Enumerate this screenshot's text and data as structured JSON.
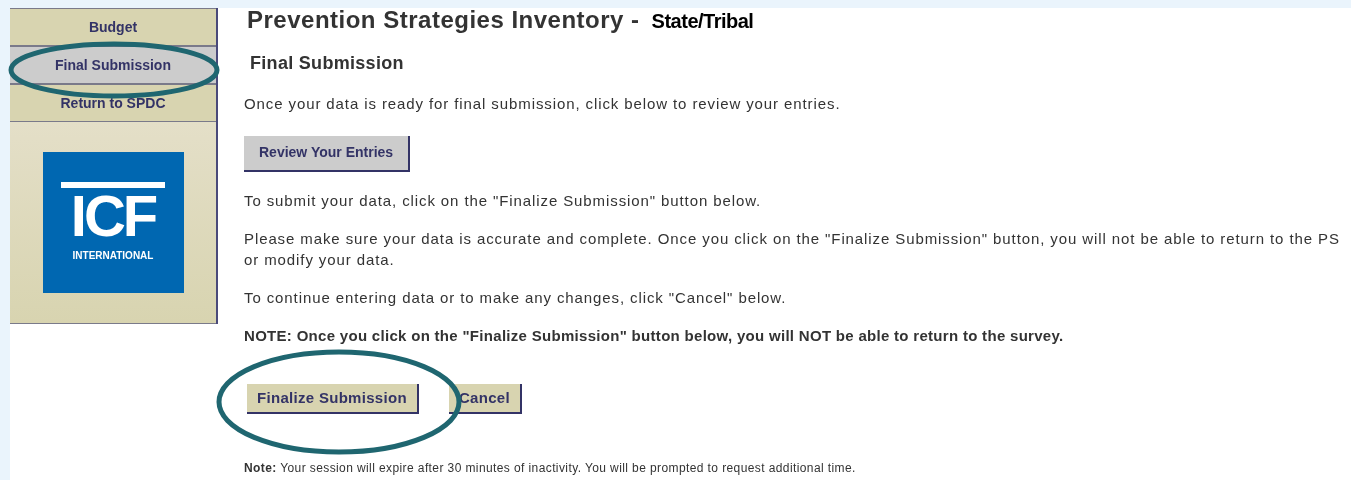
{
  "sidebar": {
    "items": [
      {
        "label": "Budget",
        "selected": false
      },
      {
        "label": "Final Submission",
        "selected": true
      },
      {
        "label": "Return to SPDC",
        "selected": false
      }
    ],
    "logo": {
      "letters": "ICF",
      "tagline": "INTERNATIONAL"
    }
  },
  "title": "Prevention Strategies Inventory -",
  "title_tag": "State/Tribal",
  "heading": "Final Submission",
  "intro": "Once your data is ready for final submission, click below to review your entries.",
  "review_button": "Review Your Entries",
  "paragraphs": [
    {
      "lines": [
        "To submit your data, click on the \"Finalize Submission\" button below."
      ]
    },
    {
      "lines": [
        "Please make sure your data is accurate and complete. Once you click on the \"Finalize Submission\" button, you will not be able to return to the PS",
        "or modify your data."
      ]
    },
    {
      "lines": [
        "To continue entering data or to make any changes, click \"Cancel\" below."
      ]
    }
  ],
  "warning": "NOTE: Once you click on the \"Finalize Submission\" button below, you will NOT be able to return to the survey.",
  "buttons": [
    {
      "label": "Finalize Submission"
    },
    {
      "label": "Cancel"
    }
  ],
  "footnote": "**Note:** Your session will expire after 30 minutes of inactivity. You will be prompted to request additional time."
}
